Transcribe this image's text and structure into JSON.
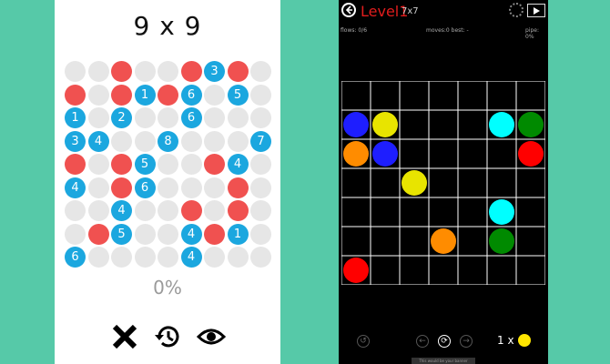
{
  "left_game": {
    "title": "9 x 9",
    "percent": "0%",
    "grid": [
      [
        "e",
        "e",
        "r",
        "e",
        "e",
        "r",
        "3",
        "r",
        "e"
      ],
      [
        "r",
        "e",
        "r",
        "1",
        "r",
        "6",
        "e",
        "5",
        "e"
      ],
      [
        "1",
        "e",
        "2",
        "e",
        "e",
        "6",
        "e",
        "e",
        "e"
      ],
      [
        "3",
        "4",
        "e",
        "e",
        "8",
        "e",
        "e",
        "e",
        "7"
      ],
      [
        "r",
        "e",
        "r",
        "5",
        "e",
        "e",
        "r",
        "4",
        "e"
      ],
      [
        "4",
        "e",
        "r",
        "6",
        "e",
        "e",
        "e",
        "r",
        "e"
      ],
      [
        "e",
        "e",
        "4",
        "e",
        "e",
        "r",
        "e",
        "r",
        "e"
      ],
      [
        "e",
        "r",
        "5",
        "e",
        "e",
        "4",
        "r",
        "1",
        "e"
      ],
      [
        "6",
        "e",
        "e",
        "e",
        "e",
        "4",
        "e",
        "e",
        "e"
      ]
    ],
    "colors": {
      "empty": "#e6e6e6",
      "red": "#f05150",
      "blue": "#1ba7df"
    },
    "controls": [
      "close-icon",
      "history-icon",
      "eye-icon"
    ]
  },
  "right_game": {
    "level": "Level1",
    "size": "7x7",
    "flows": "flows: 0/6",
    "moves": "moves:0 best: -",
    "pipe": "pipe: 0%",
    "hint_count": "1 x",
    "footer": "This would be your banner",
    "dots": [
      {
        "row": 1,
        "col": 0,
        "color": "#1e1eff"
      },
      {
        "row": 1,
        "col": 1,
        "color": "#e8e400"
      },
      {
        "row": 1,
        "col": 5,
        "color": "#00ffff"
      },
      {
        "row": 1,
        "col": 6,
        "color": "#008a00"
      },
      {
        "row": 2,
        "col": 0,
        "color": "#ff8c00"
      },
      {
        "row": 2,
        "col": 1,
        "color": "#1e1eff"
      },
      {
        "row": 2,
        "col": 6,
        "color": "#ff0000"
      },
      {
        "row": 3,
        "col": 2,
        "color": "#e8e400"
      },
      {
        "row": 4,
        "col": 5,
        "color": "#00ffff"
      },
      {
        "row": 5,
        "col": 3,
        "color": "#ff8c00"
      },
      {
        "row": 5,
        "col": 5,
        "color": "#008a00"
      },
      {
        "row": 6,
        "col": 0,
        "color": "#ff0000"
      }
    ]
  }
}
